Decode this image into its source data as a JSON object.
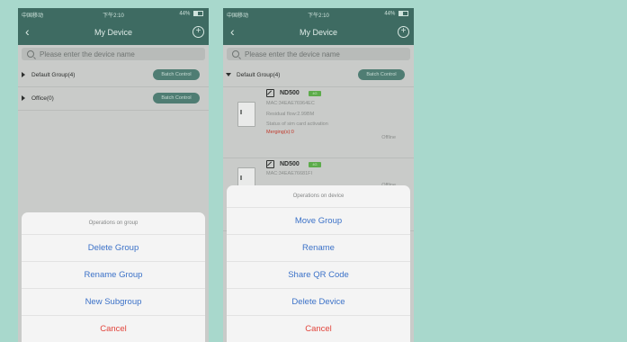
{
  "screens": [
    {
      "status": {
        "carrier": "中国移动",
        "time": "下午2:10",
        "battery": "44%"
      },
      "nav": {
        "title": "My Device"
      },
      "search": {
        "placeholder": "Please enter the device name"
      },
      "groups": [
        {
          "name": "Default Group(4)",
          "button": "Batch Control",
          "expanded": false
        },
        {
          "name": "Office(0)",
          "button": "Batch Control",
          "expanded": false
        }
      ],
      "sheet": {
        "title": "Operations on group",
        "options": [
          "Delete Group",
          "Rename Group",
          "New Subgroup"
        ],
        "cancel": "Cancel"
      }
    },
    {
      "status": {
        "carrier": "中国移动",
        "time": "下午2:10",
        "battery": "44%"
      },
      "nav": {
        "title": "My Device"
      },
      "search": {
        "placeholder": "Please enter the device name"
      },
      "groups": [
        {
          "name": "Default Group(4)",
          "button": "Batch Control",
          "expanded": true
        }
      ],
      "devices": [
        {
          "name": "ND500",
          "badge": "4G",
          "mac": "MAC:34EAE76964EC",
          "residual": "Residual flow:2.99BM",
          "sim_status": "Status of sim card activation",
          "merging": "Merging(s):0",
          "state": "Offline"
        },
        {
          "name": "ND500",
          "badge": "4G",
          "mac": "MAC:34EAE76681FI",
          "state": "Offline"
        }
      ],
      "sheet": {
        "title": "Operations on device",
        "options": [
          "Move Group",
          "Rename",
          "Share QR Code",
          "Delete Device"
        ],
        "cancel": "Cancel"
      }
    }
  ],
  "colors": {
    "background": "#a8d8cc",
    "header": "#3e6b62",
    "sheet_option": "#3c72c8",
    "cancel": "#e2453c",
    "merging": "#c0392b",
    "badge": "#5cab4a"
  }
}
